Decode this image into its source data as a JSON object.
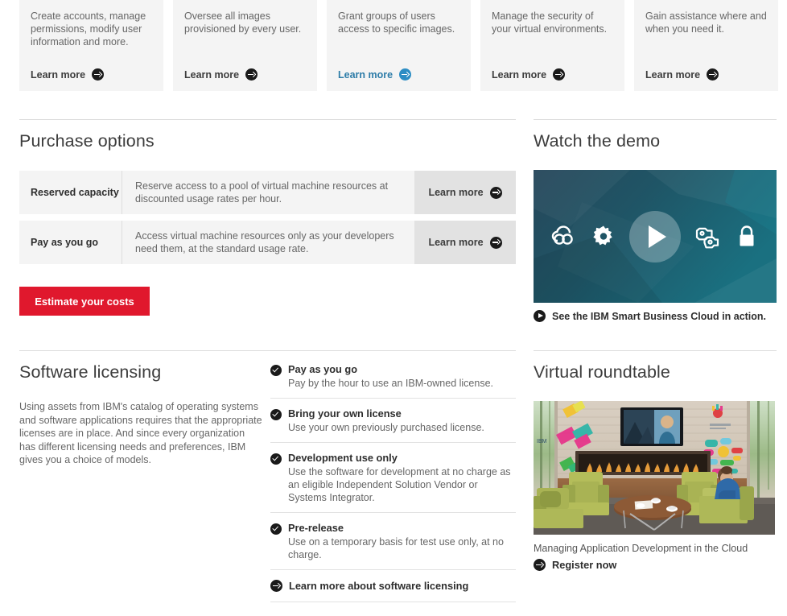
{
  "cards": [
    {
      "desc": "Create accounts, manage permissions, modify user information and more.",
      "link": "Learn more",
      "active": false
    },
    {
      "desc": "Oversee all images provisioned by every user.",
      "link": "Learn more",
      "active": false
    },
    {
      "desc": "Grant groups of users access to specific images.",
      "link": "Learn more",
      "active": true
    },
    {
      "desc": "Manage the security of your virtual environments.",
      "link": "Learn more",
      "active": false
    },
    {
      "desc": "Gain assistance where and when you need it.",
      "link": "Learn more",
      "active": false
    }
  ],
  "purchase": {
    "title": "Purchase options",
    "rows": [
      {
        "name": "Reserved capacity",
        "desc": "Reserve access to a pool of virtual machine resources at discounted usage rates per hour.",
        "cta": "Learn more"
      },
      {
        "name": "Pay as you go",
        "desc": "Access virtual machine resources only as your developers need them, at the standard usage rate.",
        "cta": "Learn more"
      }
    ],
    "estimate_button": "Estimate your costs"
  },
  "demo": {
    "title": "Watch the demo",
    "caption": "See the IBM Smart Business Cloud in action.",
    "thumb_icons": [
      "cloud-icon",
      "gear-icon",
      "play-icon",
      "network-people-icon",
      "lock-icon"
    ]
  },
  "licensing": {
    "title": "Software licensing",
    "intro": "Using assets from IBM's catalog of operating systems and software applications requires that the appropriate licenses are in place. And since every organization has different licensing needs and preferences, IBM gives you a choice of models.",
    "items": [
      {
        "title": "Pay as you go",
        "sub": "Pay by the hour to use an IBM-owned license."
      },
      {
        "title": "Bring your own license",
        "sub": "Use your own previously purchased license."
      },
      {
        "title": "Development use only",
        "sub": "Use the software for development at no charge as an eligible Independent Solution Vendor or Systems Integrator."
      },
      {
        "title": "Pre-release",
        "sub": "Use on a temporary basis for test use only, at no charge."
      }
    ],
    "more_link": "Learn more about software licensing"
  },
  "roundtable": {
    "title": "Virtual roundtable",
    "caption": "Managing Application Development in the Cloud",
    "register": "Register now"
  },
  "colors": {
    "accent_red": "#e0182d",
    "link_blue": "#2d7ca8",
    "card_bg": "#f4f4f4",
    "cta_bg": "#e2e2e2",
    "text_gray": "#666666"
  }
}
